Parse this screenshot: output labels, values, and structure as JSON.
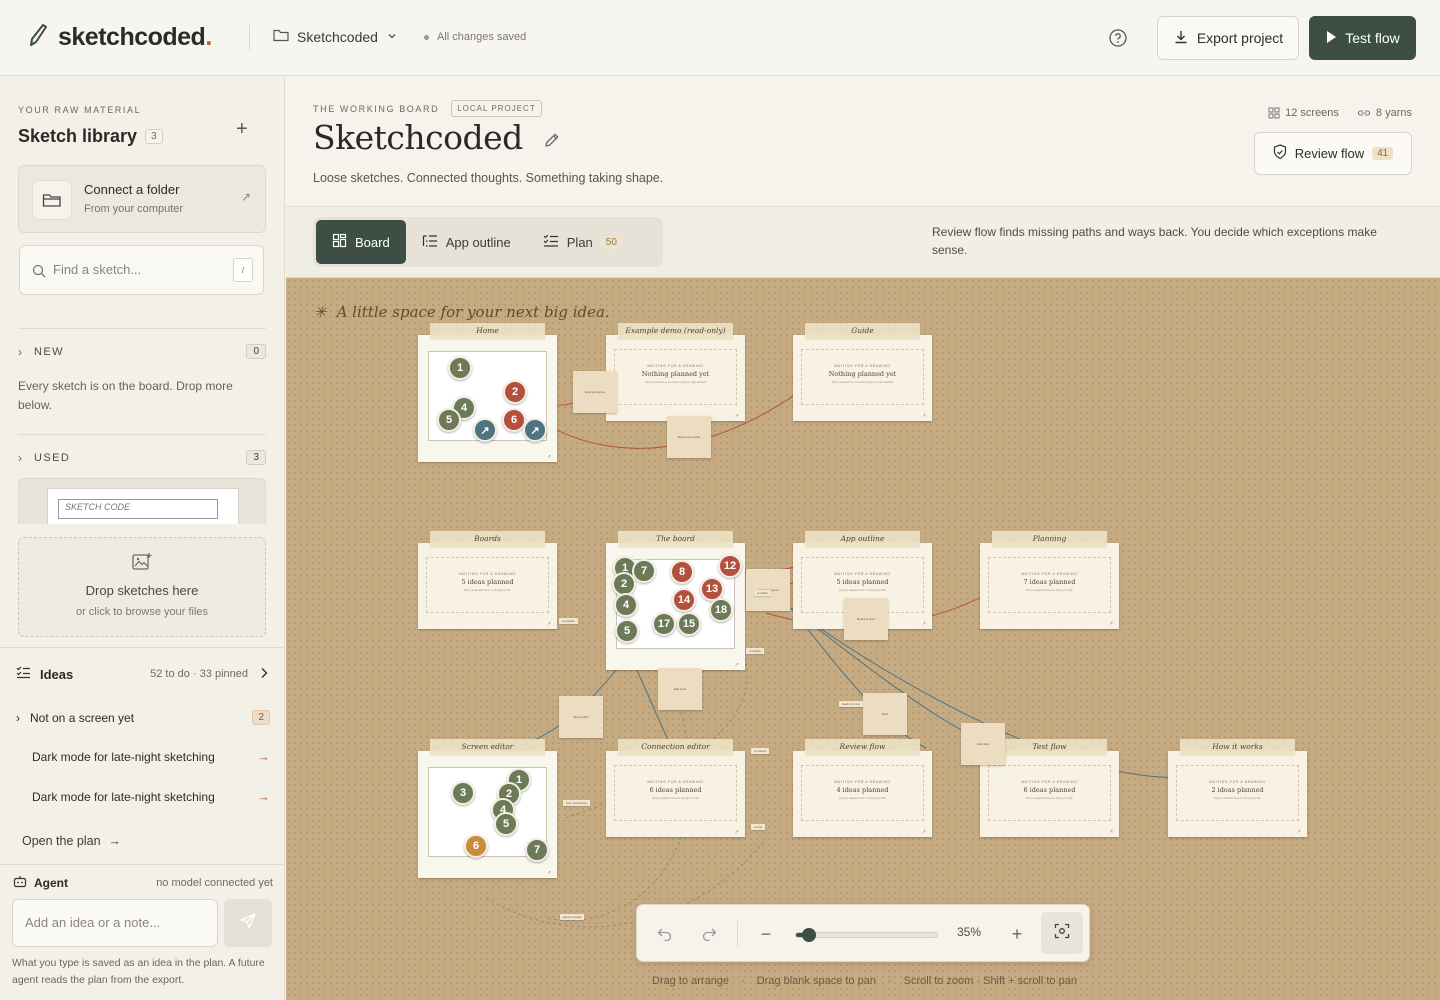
{
  "topbar": {
    "brand": "sketchcoded",
    "brand_dot": ".",
    "project_name": "Sketchcoded",
    "save_status": "All changes saved",
    "export_label": "Export project",
    "test_label": "Test flow"
  },
  "sidebar": {
    "overline": "YOUR RAW MATERIAL",
    "title": "Sketch library",
    "count": "3",
    "connect_title": "Connect a folder",
    "connect_sub": "From your computer",
    "search_placeholder": "Find a sketch...",
    "search_kbd": "/",
    "new_label": "NEW",
    "new_count": "0",
    "empty_text": "Every sketch is on the board. Drop more below.",
    "used_label": "USED",
    "used_count": "3",
    "used_thumb_text": "SKETCH CODE",
    "drop_title": "Drop sketches here",
    "drop_sub": "or click to browse your files",
    "ideas_title": "Ideas",
    "ideas_meta": "52 to do · 33 pinned",
    "not_on_screen": "Not on a screen yet",
    "not_on_screen_count": "2",
    "idea_items": [
      "Dark mode for late-night sketching",
      "Dark mode for late-night sketching"
    ],
    "open_plan": "Open the plan",
    "agent_title": "Agent",
    "agent_meta": "no model connected yet",
    "agent_placeholder": "Add an idea or a note...",
    "agent_note": "What you type is saved as an idea in the plan. A future agent reads the plan from the export."
  },
  "header": {
    "overline": "THE WORKING BOARD",
    "local_chip": "LOCAL PROJECT",
    "title": "Sketchcoded",
    "tagline": "Loose sketches. Connected thoughts. Something taking shape.",
    "screens": "12 screens",
    "yarns": "8 yarns",
    "review_label": "Review flow",
    "review_count": "41"
  },
  "tabs": {
    "items": [
      {
        "label": "Board",
        "count": ""
      },
      {
        "label": "App outline",
        "count": ""
      },
      {
        "label": "Plan",
        "count": "50"
      }
    ],
    "note": "Review flow finds missing paths and ways back. You decide which exceptions make sense."
  },
  "board": {
    "hint": "A little space for your next big idea.",
    "screens": [
      {
        "name": "Home",
        "waiting": "",
        "main": "",
        "sub": ""
      },
      {
        "name": "Example demo (read-only)",
        "waiting": "WAITING FOR A DRAWING",
        "main": "Nothing planned yet",
        "sub": "Drop a sketch or connect a yarn to get started"
      },
      {
        "name": "Guide",
        "waiting": "WAITING FOR A DRAWING",
        "main": "Nothing planned yet",
        "sub": "Drop a sketch or connect a yarn to get started"
      },
      {
        "name": "Boards",
        "waiting": "WAITING FOR A DRAWING",
        "main": "5 ideas planned",
        "sub": "Drop a sketch here to bring it to life"
      },
      {
        "name": "The board",
        "waiting": "",
        "main": "",
        "sub": ""
      },
      {
        "name": "App outline",
        "waiting": "WAITING FOR A DRAWING",
        "main": "5 ideas planned",
        "sub": "Drop a sketch here to bring it to life"
      },
      {
        "name": "Planning",
        "waiting": "WAITING FOR A DRAWING",
        "main": "7 ideas planned",
        "sub": "Drop a sketch here to bring it to life"
      },
      {
        "name": "Screen editor",
        "waiting": "",
        "main": "",
        "sub": ""
      },
      {
        "name": "Connection editor",
        "waiting": "WAITING FOR A DRAWING",
        "main": "6 ideas planned",
        "sub": "Drop a sketch here to bring it to life"
      },
      {
        "name": "Review flow",
        "waiting": "WAITING FOR A DRAWING",
        "main": "4 ideas planned",
        "sub": "Drop a sketch here to bring it to life"
      },
      {
        "name": "Test flow",
        "waiting": "WAITING FOR A DRAWING",
        "main": "6 ideas planned",
        "sub": "Drop a sketch here to bring it to life"
      },
      {
        "name": "How it works",
        "waiting": "WAITING FOR A DRAWING",
        "main": "2 ideas planned",
        "sub": "Drop a sketch here to bring it to life"
      }
    ],
    "notes": [
      "Example demo",
      "Read-only Guide",
      "Compare layout",
      "Board-to-flow",
      "Edit a pin",
      "Open editor",
      "Flow",
      "Hub links"
    ],
    "labels": [
      "to boards",
      "to outline",
      "back to home",
      "to review",
      "from connection",
      "to test",
      "back to board",
      "to editor"
    ],
    "zoom_value": "35%",
    "zoom_level": 0.09,
    "hints": [
      "Drag to arrange",
      "Drag blank space to pan",
      "Scroll to zoom · Shift + scroll to pan"
    ]
  },
  "colors": {
    "accent": "#3d4f44",
    "brand_dot": "#c05a3a",
    "board_bg": "#c5aa82",
    "yarn_red": "#b4513e",
    "yarn_blue": "#4e7482"
  }
}
